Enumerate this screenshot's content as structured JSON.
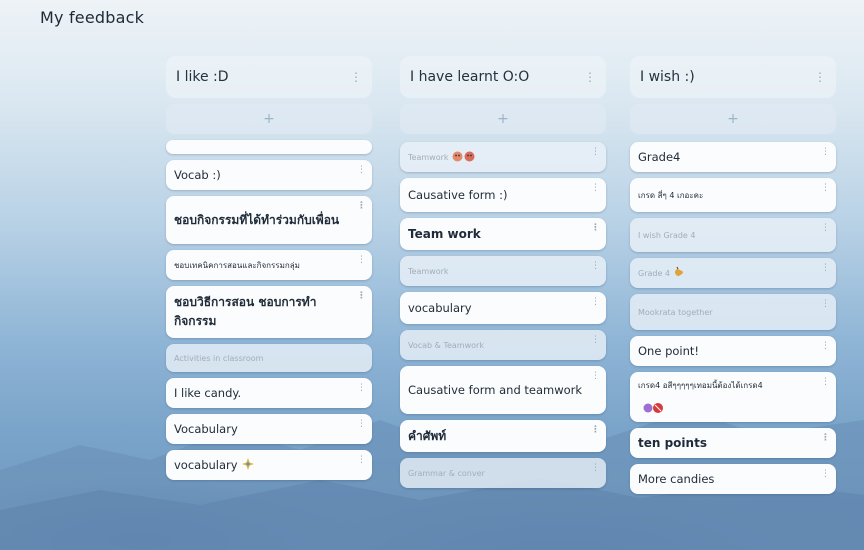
{
  "board": {
    "title": "My feedback"
  },
  "columns": [
    {
      "title": "I like :D",
      "add": "+",
      "cards": [
        {
          "text": ""
        },
        {
          "text": "Vocab :)"
        },
        {
          "text": "ชอบกิจกรรมที่ได้ทำร่วมกับเพื่อน"
        },
        {
          "text": "ชอบเทคนิคการสอนและกิจกรรมกลุ่ม"
        },
        {
          "text": "ชอบวิธีการสอน ชอบการทำกิจกรรม"
        },
        {
          "text": "Activities in classroom"
        },
        {
          "text": "I like candy."
        },
        {
          "text": "Vocabulary"
        },
        {
          "text": "vocabulary",
          "icon": "sparkle"
        }
      ]
    },
    {
      "title": "I have learnt O:O",
      "add": "+",
      "cards": [
        {
          "text": "Teamwork",
          "icon": "faces"
        },
        {
          "text": "Causative form :)"
        },
        {
          "text": "Team work"
        },
        {
          "text": "Teamwork"
        },
        {
          "text": "vocabulary"
        },
        {
          "text": "Vocab & Teamwork"
        },
        {
          "text": "Causative form and teamwork"
        },
        {
          "text": "คำศัพท์"
        },
        {
          "text": "Grammar & conver"
        }
      ]
    },
    {
      "title": "I wish :)",
      "add": "+",
      "cards": [
        {
          "text": "Grade4"
        },
        {
          "text": "เกรด สี่ๆ 4 เกอะคะ"
        },
        {
          "text": "I wish Grade 4"
        },
        {
          "text": "Grade 4",
          "icon": "hand"
        },
        {
          "text": "Mookrata together"
        },
        {
          "text": "One point!"
        },
        {
          "text": "เกรด4 อสีๆๆๆๆๆเทอมนี้ต้องได้เกรด4",
          "icon": "candy"
        },
        {
          "text": "ten points"
        },
        {
          "text": "More candies"
        }
      ]
    }
  ],
  "ui": {
    "menu_icon": "⋮"
  }
}
